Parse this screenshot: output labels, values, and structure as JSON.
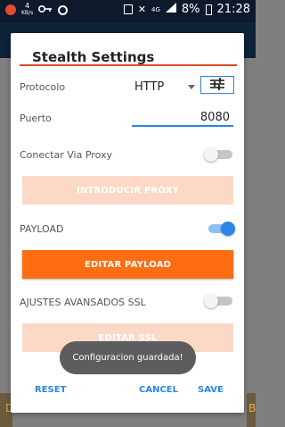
{
  "status_bar": {
    "speed_value": "4",
    "speed_unit": "KB/s",
    "network_type": "4G",
    "battery": "8%",
    "time": "21:28"
  },
  "background": {
    "left_fragment": "D",
    "right_fragment": "B"
  },
  "dialog": {
    "title": "Stealth Settings",
    "protocolo_label": "Protocolo",
    "protocolo_value": "HTTP",
    "puerto_label": "Puerto",
    "puerto_value": "8080",
    "proxy_label": "Conectar Via Proxy",
    "proxy_enabled": false,
    "introducir_proxy_label": "INTRODUCIR PROXY",
    "payload_label": "PAYLOAD",
    "payload_enabled": true,
    "editar_payload_label": "EDITAR PAYLOAD",
    "ssl_label": "AJUSTES AVANSADOS SSL",
    "ssl_enabled": false,
    "editar_ssl_label": "EDITAR SSL",
    "reset_label": "RESET",
    "cancel_label": "CANCEL",
    "save_label": "SAVE"
  },
  "toast": {
    "message": "Configuracion guardada!"
  },
  "colors": {
    "accent": "#2a87e6",
    "orange": "#ff6d12",
    "title_underline": "#d94a2a"
  }
}
